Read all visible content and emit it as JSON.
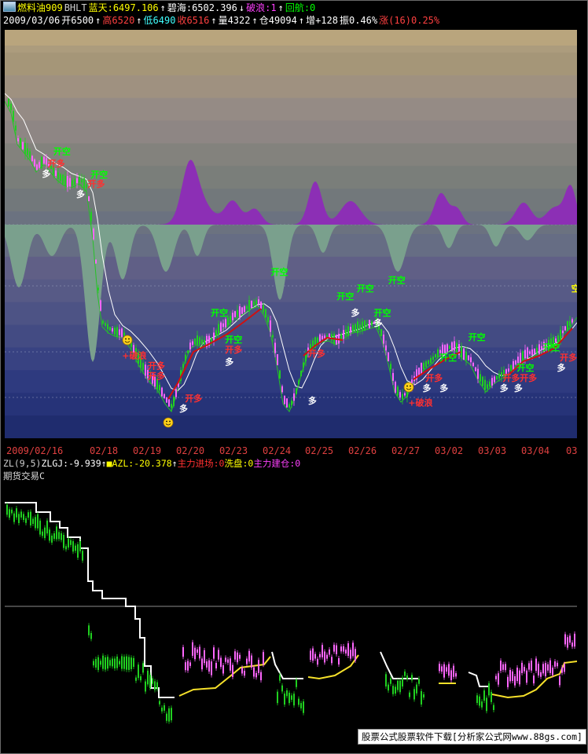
{
  "window": {
    "title_line": [
      {
        "text": "燃料油909",
        "color": "#ffff00"
      },
      {
        "text": "BHLT",
        "color": "#cfcfcf"
      },
      {
        "text": "蓝天:6497.106",
        "color": "#ffff00"
      },
      {
        "text": "↑",
        "color": "#ffffff"
      },
      {
        "text": "碧海:6502.396",
        "color": "#ffffff"
      },
      {
        "text": "↓",
        "color": "#ffffff"
      },
      {
        "text": "破浪:1",
        "color": "#ff40ff"
      },
      {
        "text": "↑",
        "color": "#ffffff"
      },
      {
        "text": "回航:0",
        "color": "#00ff00"
      }
    ],
    "quote_line": [
      {
        "text": "2009/03/06",
        "color": "#ffffff"
      },
      {
        "text": "开6500",
        "color": "#ffffff"
      },
      {
        "text": "↑",
        "color": "#ffffff"
      },
      {
        "text": "高6520",
        "color": "#ff4040"
      },
      {
        "text": "↑",
        "color": "#ffffff"
      },
      {
        "text": "低6490",
        "color": "#40ffff"
      },
      {
        "text": "收6516",
        "color": "#ff4040"
      },
      {
        "text": "↑",
        "color": "#ffffff"
      },
      {
        "text": "量4322",
        "color": "#ffffff"
      },
      {
        "text": "↑",
        "color": "#ffffff"
      },
      {
        "text": "仓49094",
        "color": "#ffffff"
      },
      {
        "text": "↑",
        "color": "#ffffff"
      },
      {
        "text": "增+128",
        "color": "#ffffff"
      },
      {
        "text": "振0.46%",
        "color": "#ffffff"
      },
      {
        "text": "涨(16)0.25%",
        "color": "#ff4040"
      }
    ]
  },
  "dates": [
    "2009/02/16",
    "02/18",
    "02/19",
    "02/20",
    "02/23",
    "02/24",
    "02/25",
    "02/26",
    "02/27",
    "03/02",
    "03/03",
    "03/04",
    "03"
  ],
  "indicator_line": [
    {
      "text": "ZL(9,5)",
      "color": "#cfcfcf"
    },
    {
      "text": "ZLGJ:-9.939",
      "color": "#ffffff"
    },
    {
      "text": "↑",
      "color": "#ffffff"
    },
    {
      "text": "■AZL:-20.378",
      "color": "#ffff00"
    },
    {
      "text": "↑",
      "color": "#ffffff"
    },
    {
      "text": "主力进场:0",
      "color": "#ff3030"
    },
    {
      "text": "洗盘:0",
      "color": "#ffff00"
    },
    {
      "text": "主力建仓:0",
      "color": "#ff40ff"
    }
  ],
  "indicator_title": "期货交易C",
  "watermark": "股票公式股票软件下载[分析家公式网www.88gs.com]",
  "chart_data": [
    {
      "type": "candlestick",
      "name": "main",
      "x_dates": [
        "2009/02/16",
        "02/18",
        "02/19",
        "02/20",
        "02/23",
        "02/24",
        "02/25",
        "02/26",
        "02/27",
        "03/02",
        "03/03",
        "03/04",
        "03"
      ],
      "signals": [
        {
          "label": "开多",
          "color": "#ff3030",
          "x": 0.075,
          "y": 0.335
        },
        {
          "label": "多",
          "color": "#ffffff",
          "x": 0.065,
          "y": 0.36
        },
        {
          "label": "开空",
          "color": "#00ff00",
          "x": 0.085,
          "y": 0.305
        },
        {
          "label": "开多",
          "color": "#ff3030",
          "x": 0.145,
          "y": 0.385
        },
        {
          "label": "多",
          "color": "#ffffff",
          "x": 0.125,
          "y": 0.41
        },
        {
          "label": "开空",
          "color": "#00ff00",
          "x": 0.15,
          "y": 0.362
        },
        {
          "label": "+破浪",
          "color": "#ff3030",
          "x": 0.205,
          "y": 0.805
        },
        {
          "label": "开多",
          "color": "#ff3030",
          "x": 0.25,
          "y": 0.83
        },
        {
          "label": "开多",
          "color": "#ff3030",
          "x": 0.25,
          "y": 0.855
        },
        {
          "label": "开多",
          "color": "#ff3030",
          "x": 0.315,
          "y": 0.91
        },
        {
          "label": "多",
          "color": "#ffffff",
          "x": 0.305,
          "y": 0.935
        },
        {
          "label": "开空",
          "color": "#00ff00",
          "x": 0.36,
          "y": 0.7
        },
        {
          "label": "开空",
          "color": "#00ff00",
          "x": 0.385,
          "y": 0.765
        },
        {
          "label": "开多",
          "color": "#ff3030",
          "x": 0.385,
          "y": 0.79
        },
        {
          "label": "多",
          "color": "#ffffff",
          "x": 0.385,
          "y": 0.82
        },
        {
          "label": "开空",
          "color": "#00ff00",
          "x": 0.465,
          "y": 0.6
        },
        {
          "label": "开多",
          "color": "#ff3030",
          "x": 0.53,
          "y": 0.8
        },
        {
          "label": "多",
          "color": "#ffffff",
          "x": 0.53,
          "y": 0.915
        },
        {
          "label": "开空",
          "color": "#00ff00",
          "x": 0.58,
          "y": 0.66
        },
        {
          "label": "多",
          "color": "#ffffff",
          "x": 0.605,
          "y": 0.7
        },
        {
          "label": "开空",
          "color": "#00ff00",
          "x": 0.615,
          "y": 0.64
        },
        {
          "label": "开空",
          "color": "#00ff00",
          "x": 0.67,
          "y": 0.62
        },
        {
          "label": "开空",
          "color": "#00ff00",
          "x": 0.645,
          "y": 0.7
        },
        {
          "label": "多",
          "color": "#ffffff",
          "x": 0.645,
          "y": 0.725
        },
        {
          "label": "+破浪",
          "color": "#ff3030",
          "x": 0.705,
          "y": 0.92
        },
        {
          "label": "开多",
          "color": "#ff3030",
          "x": 0.735,
          "y": 0.86
        },
        {
          "label": "多",
          "color": "#ffffff",
          "x": 0.73,
          "y": 0.885
        },
        {
          "label": "开空",
          "color": "#00ff00",
          "x": 0.76,
          "y": 0.81
        },
        {
          "label": "多",
          "color": "#ffffff",
          "x": 0.76,
          "y": 0.885
        },
        {
          "label": "开空",
          "color": "#00ff00",
          "x": 0.81,
          "y": 0.76
        },
        {
          "label": "开多",
          "color": "#ff3030",
          "x": 0.87,
          "y": 0.86
        },
        {
          "label": "多",
          "color": "#ffffff",
          "x": 0.865,
          "y": 0.885
        },
        {
          "label": "开多",
          "color": "#ff3030",
          "x": 0.9,
          "y": 0.86
        },
        {
          "label": "开空",
          "color": "#00ff00",
          "x": 0.895,
          "y": 0.835
        },
        {
          "label": "多",
          "color": "#ffffff",
          "x": 0.89,
          "y": 0.885
        },
        {
          "label": "开空",
          "color": "#00ff00",
          "x": 0.94,
          "y": 0.785
        },
        {
          "label": "开多",
          "color": "#ff3030",
          "x": 0.97,
          "y": 0.81
        },
        {
          "label": "多",
          "color": "#ffffff",
          "x": 0.965,
          "y": 0.835
        },
        {
          "label": "空",
          "color": "#ffff00",
          "x": 0.99,
          "y": 0.64
        }
      ]
    },
    {
      "type": "line",
      "name": "ZL(9,5)",
      "title": "期货交易C"
    }
  ]
}
